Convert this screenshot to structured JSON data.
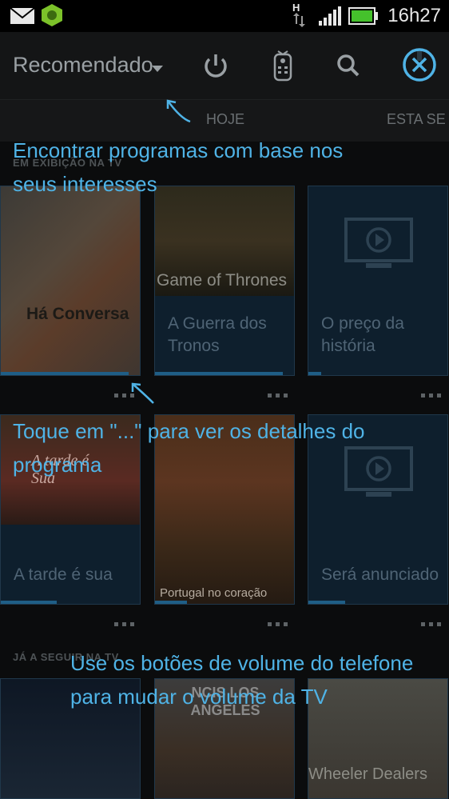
{
  "status_bar": {
    "time": "16h27",
    "network_type": "H",
    "icons": [
      "mail-icon",
      "app-shield-icon",
      "data-arrows-icon",
      "signal-icon",
      "battery-icon"
    ]
  },
  "app_bar": {
    "title": "Recomendado",
    "icons": [
      "power-icon",
      "remote-icon",
      "search-icon",
      "close-icon"
    ]
  },
  "tabs": [
    "HOJE",
    "ESTA SE"
  ],
  "sections": [
    {
      "label": "EM EXIBIÇÃO NA TV",
      "cards": [
        {
          "overlay": "Há Conversa",
          "caption": ""
        },
        {
          "overlay": "Game of Thrones",
          "caption": "A Guerra dos Tronos"
        },
        {
          "overlay": "",
          "caption": "O preço da história"
        }
      ]
    },
    {
      "label": "",
      "cards": [
        {
          "overlay": "A tarde é Sua",
          "caption": "A tarde é sua"
        },
        {
          "overlay": "Portugal no coração",
          "caption": ""
        },
        {
          "overlay": "",
          "caption": "Será anunciado"
        }
      ]
    },
    {
      "label": "JÁ A SEGUIR NA TV",
      "cards": [
        {
          "overlay": "",
          "caption": ""
        },
        {
          "overlay": "NCIS LOS ANGELES",
          "caption": ""
        },
        {
          "overlay": "Wheeler Dealers",
          "caption": ""
        }
      ]
    }
  ],
  "hints": {
    "interests": "Encontrar programas com base nos seus interesses",
    "details": "Toque em \"...\" para ver os detalhes do programa",
    "volume": "Use os botões de volume do telefone para mudar o volume da TV"
  },
  "colors": {
    "accent": "#4fb3e6",
    "card_bg": "#0e1f2d",
    "progress": "#1f5e86"
  }
}
